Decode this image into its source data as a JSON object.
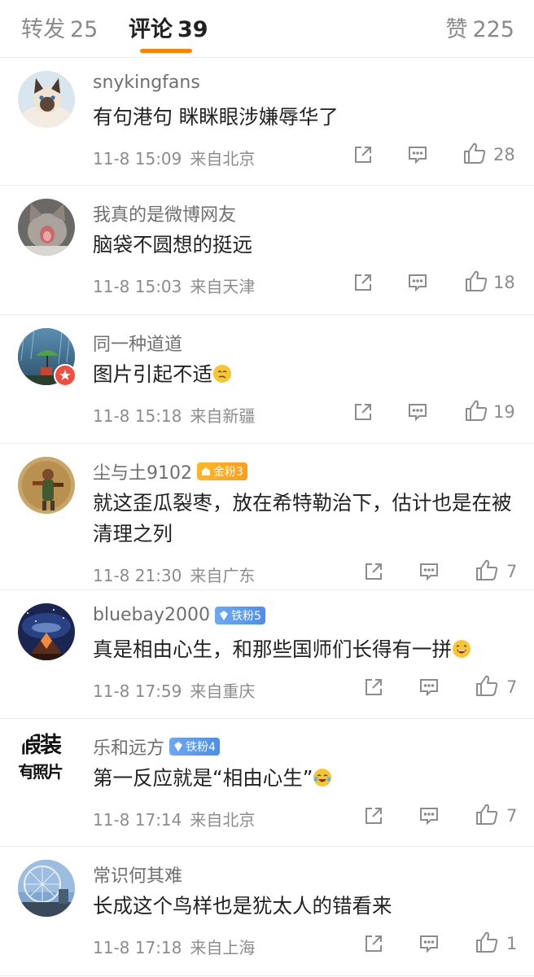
{
  "tabs": [
    {
      "label": "转发",
      "count": "25"
    },
    {
      "label": "评论",
      "count": "39"
    },
    {
      "label": "赞",
      "count": "225"
    }
  ],
  "colors": {
    "accent": "#ff8200",
    "meta": "#8c8c8c",
    "username": "#6f6f6f"
  },
  "comments": [
    {
      "user": "snykingfans",
      "text": "有句港句 眯眯眼涉嫌辱华了",
      "time": "11-8 15:09",
      "source": "来自北京",
      "likes": "28"
    },
    {
      "user": "我真的是微博网友",
      "text": "脑袋不圆想的挺远",
      "time": "11-8 15:03",
      "source": "来自天津",
      "likes": "18"
    },
    {
      "user": "同一种道道",
      "text": "图片引起不适",
      "time": "11-8 15:18",
      "source": "来自新疆",
      "likes": "19"
    },
    {
      "user": "尘与土9102",
      "badge": "金粉3",
      "text": "就这歪瓜裂枣，放在希特勒治下，估计也是在被清理之列",
      "time": "11-8 21:30",
      "source": "来自广东",
      "likes": "7"
    },
    {
      "user": "bluebay2000",
      "badge": "铁粉5",
      "text": "真是相由心生，和那些国师们长得有一拼",
      "time": "11-8 17:59",
      "source": "来自重庆",
      "likes": "7"
    },
    {
      "user": "乐和远方",
      "badge": "铁粉4",
      "avatar_text": [
        "假装",
        "有照片"
      ],
      "text": "第一反应就是“相由心生”",
      "time": "11-8 17:14",
      "source": "来自北京",
      "likes": "7"
    },
    {
      "user": "常识何其难",
      "text": "长成这个鸟样也是犹太人的错看来",
      "time": "11-8 17:18",
      "source": "来自上海",
      "likes": "1"
    }
  ]
}
